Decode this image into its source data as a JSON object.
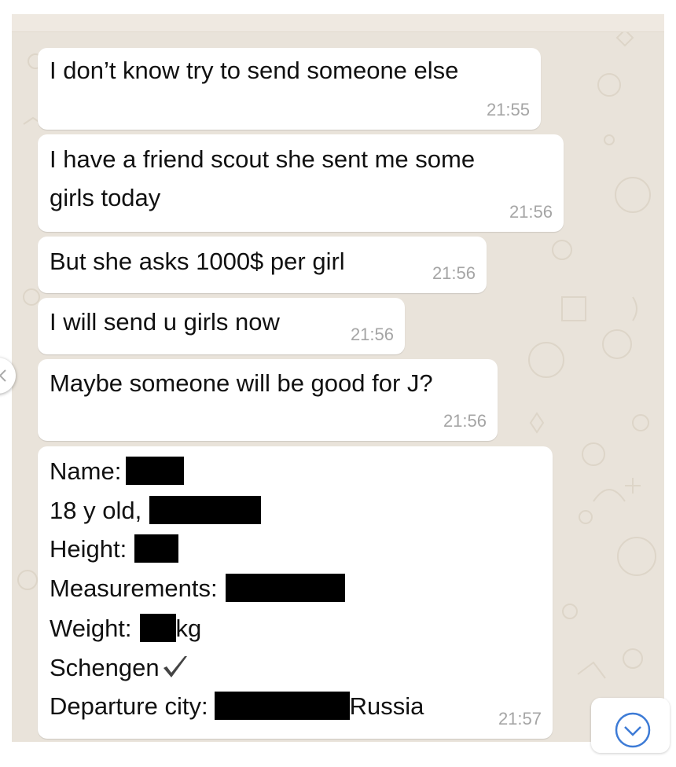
{
  "messages": [
    {
      "lines": [
        "I don’t know try to send someone else"
      ],
      "time": "21:55"
    },
    {
      "lines": [
        "I have a friend scout she sent me some",
        "girls today"
      ],
      "time": "21:56"
    },
    {
      "lines": [
        "But she asks 1000$  per girl"
      ],
      "time": "21:56"
    },
    {
      "lines": [
        "I will send u girls now"
      ],
      "time": "21:56"
    },
    {
      "lines": [
        "Maybe someone will be good for J?"
      ],
      "time": "21:56"
    }
  ],
  "profile": {
    "name_label": "Name:",
    "age_label": "18 y old,",
    "height_label": "Height:",
    "measurements_label": "Measurements:",
    "weight_label": "Weight:",
    "weight_unit": "kg",
    "schengen_label": "Schengen",
    "departure_label": "Departure city:",
    "departure_country": "Russia",
    "time": "21:57",
    "check_icon": "checkmark-icon"
  },
  "icons": {
    "scroll_down": "chevron-down-circle-icon",
    "side_handle": "chevron-left-icon"
  },
  "colors": {
    "chat_background": "#e9e3da",
    "bubble": "#ffffff",
    "timestamp": "#a5a5a5",
    "redaction": "#000000"
  }
}
